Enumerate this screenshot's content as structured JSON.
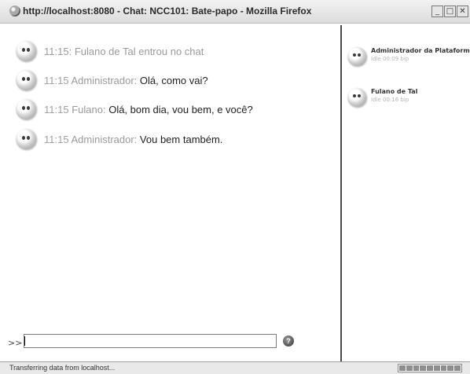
{
  "window": {
    "title": "http://localhost:8080 - Chat: NCC101: Bate-papo - Mozilla Firefox",
    "minimize_icon": "minimize-icon",
    "maximize_icon": "maximize-icon",
    "close_icon": "close-icon",
    "minimize_glyph": "_",
    "maximize_glyph": "□",
    "close_glyph": "✕"
  },
  "chat": {
    "messages": [
      {
        "time": "11:15:",
        "author": "",
        "text": "Fulano de Tal entrou no chat",
        "system": true
      },
      {
        "time": "11:15",
        "author": "Administrador:",
        "text": "Olá, como vai?",
        "system": false
      },
      {
        "time": "11:15",
        "author": "Fulano:",
        "text": "Olá, bom dia, vou bem, e você?",
        "system": false
      },
      {
        "time": "11:15",
        "author": "Administrador:",
        "text": "Vou bem também.",
        "system": false
      }
    ],
    "input": {
      "prompt": ">>",
      "value": "",
      "placeholder": ""
    },
    "help_label": "?"
  },
  "users": [
    {
      "name": "Administrador da Plataforma",
      "status": "Idle 00:09",
      "action": "bip"
    },
    {
      "name": "Fulano de Tal",
      "status": "Idle 00:16",
      "action": "bip"
    }
  ],
  "statusbar": {
    "text": "Transferring data from localhost...",
    "progress_segments": 9
  }
}
